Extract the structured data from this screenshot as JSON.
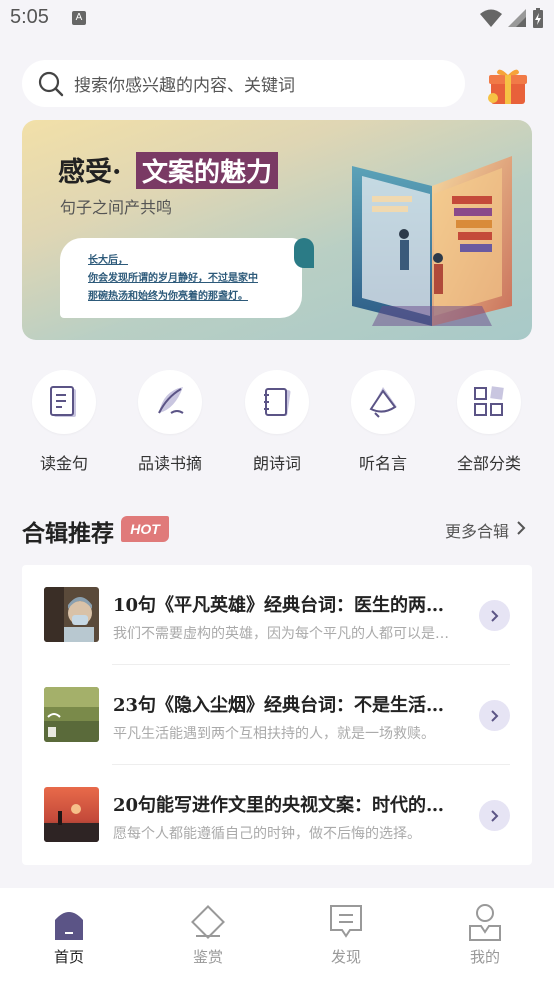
{
  "status_bar": {
    "time": "5:05",
    "notification_letter": "A"
  },
  "search": {
    "placeholder": "搜索你感兴趣的内容、关键词"
  },
  "banner": {
    "title_prefix": "感受·",
    "title_highlight": "文案的魅力",
    "subtitle": "句子之间产共鸣",
    "quote_lines": [
      "长大后，",
      "你会发现所谓的岁月静好，不过是家中",
      "那碗热汤和始终为你亮着的那盏灯。"
    ]
  },
  "categories": [
    {
      "label": "读金句",
      "icon": "document-icon"
    },
    {
      "label": "品读书摘",
      "icon": "quill-icon"
    },
    {
      "label": "朗诗词",
      "icon": "notebook-icon"
    },
    {
      "label": "听名言",
      "icon": "megaphone-icon"
    },
    {
      "label": "全部分类",
      "icon": "grid-icon"
    }
  ],
  "collections": {
    "title": "合辑推荐",
    "badge": "HOT",
    "more_label": "更多合辑",
    "items": [
      {
        "title": "10句《平凡英雄》经典台词：医生的两…",
        "desc": "我们不需要虚构的英雄，因为每个平凡的人都可以是…"
      },
      {
        "title": "23句《隐入尘烟》经典台词：不是生活…",
        "desc": "平凡生活能遇到两个互相扶持的人，就是一场救赎。"
      },
      {
        "title": "20句能写进作文里的央视文案：时代的…",
        "desc": "愿每个人都能遵循自己的时钟，做不后悔的选择。"
      }
    ]
  },
  "tabs": [
    {
      "label": "首页",
      "active": true
    },
    {
      "label": "鉴赏",
      "active": false
    },
    {
      "label": "发现",
      "active": false
    },
    {
      "label": "我的",
      "active": false
    }
  ],
  "colors": {
    "accent": "#5b5486",
    "hot": "#e07a7a",
    "banner_highlight": "#7a3a64"
  }
}
